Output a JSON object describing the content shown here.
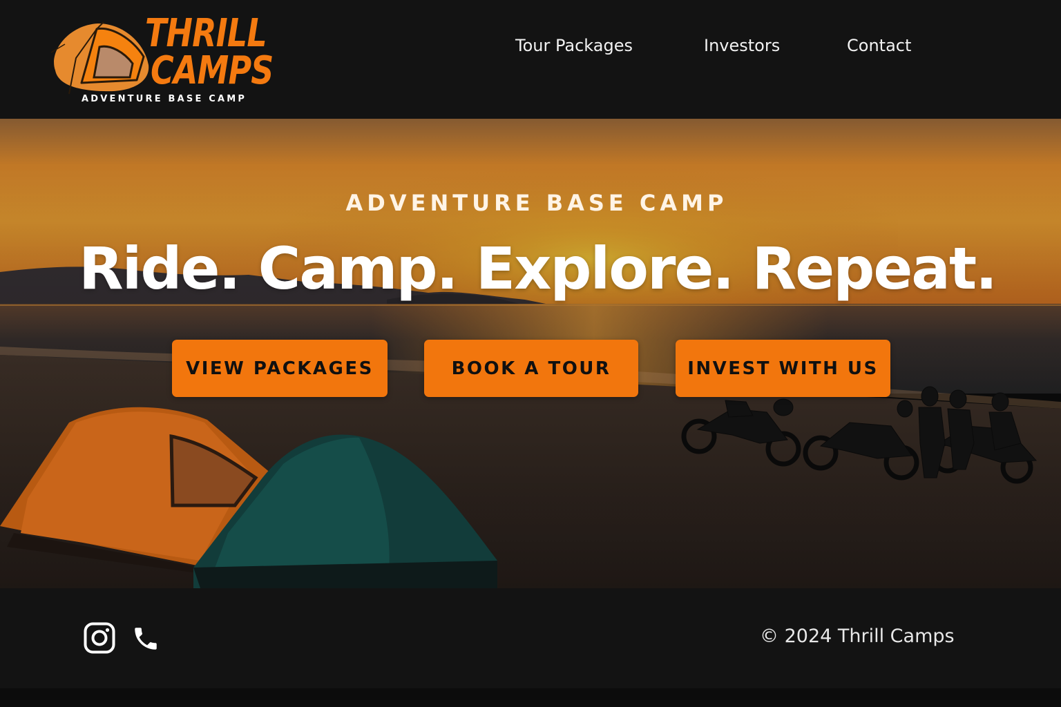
{
  "brand": {
    "name_line1": "THRILL",
    "name_line2": "CAMPS",
    "tagline": "ADVENTURE BASE CAMP"
  },
  "nav": {
    "items": [
      {
        "label": "Tour Packages"
      },
      {
        "label": "Investors"
      },
      {
        "label": "Contact"
      }
    ]
  },
  "hero": {
    "eyebrow": "ADVENTURE BASE CAMP",
    "headline": "Ride. Camp. Explore. Repeat.",
    "buttons": [
      {
        "label": "VIEW PACKAGES"
      },
      {
        "label": "BOOK A TOUR"
      },
      {
        "label": "INVEST WITH US"
      }
    ]
  },
  "footer": {
    "icons": [
      "instagram-icon",
      "phone-icon"
    ],
    "copyright": "© 2024 Thrill Camps"
  },
  "colors": {
    "accent": "#f2760d",
    "header_bg": "#131313",
    "text": "#ffffff"
  }
}
